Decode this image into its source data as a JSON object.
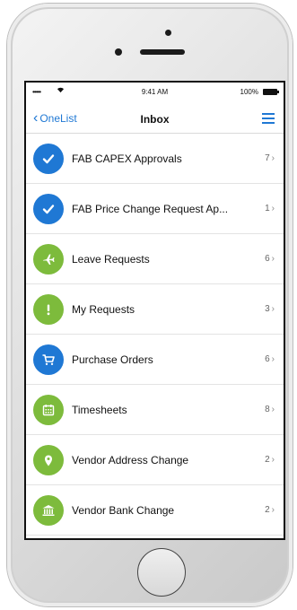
{
  "status_bar": {
    "time": "9:41 AM",
    "battery": "100%",
    "signal": "•••••"
  },
  "nav": {
    "back_label": "OneList",
    "title": "Inbox"
  },
  "colors": {
    "blue": "#1f78d4",
    "green": "#7dbb3c"
  },
  "items": [
    {
      "label": "FAB CAPEX Approvals",
      "count": "7",
      "icon": "check-icon",
      "color": "blue"
    },
    {
      "label": "FAB Price Change Request Ap...",
      "count": "1",
      "icon": "check-icon",
      "color": "blue"
    },
    {
      "label": "Leave Requests",
      "count": "6",
      "icon": "airplane-icon",
      "color": "green"
    },
    {
      "label": "My Requests",
      "count": "3",
      "icon": "exclamation-icon",
      "color": "green"
    },
    {
      "label": "Purchase Orders",
      "count": "6",
      "icon": "cart-icon",
      "color": "blue"
    },
    {
      "label": "Timesheets",
      "count": "8",
      "icon": "calendar-icon",
      "color": "green"
    },
    {
      "label": "Vendor Address Change",
      "count": "2",
      "icon": "map-pin-icon",
      "color": "green"
    },
    {
      "label": "Vendor Bank Change",
      "count": "2",
      "icon": "bank-icon",
      "color": "green"
    }
  ]
}
